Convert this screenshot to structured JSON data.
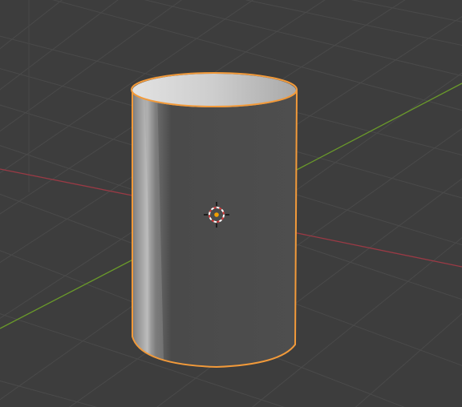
{
  "viewport": {
    "background_color": "#3d3d3d",
    "grid_color": "#4a4a4a",
    "x_axis_color": "#9a3a45",
    "y_axis_color": "#6a9a2a"
  },
  "object": {
    "type": "cylinder",
    "selected": true,
    "selection_outline_color": "#f29a3a",
    "side_color": "#4c4c4c",
    "top_face_color": "#c8c8c8"
  },
  "cursor_3d": {
    "icon": "3d-cursor-icon",
    "origin_color": "#f2a000"
  }
}
